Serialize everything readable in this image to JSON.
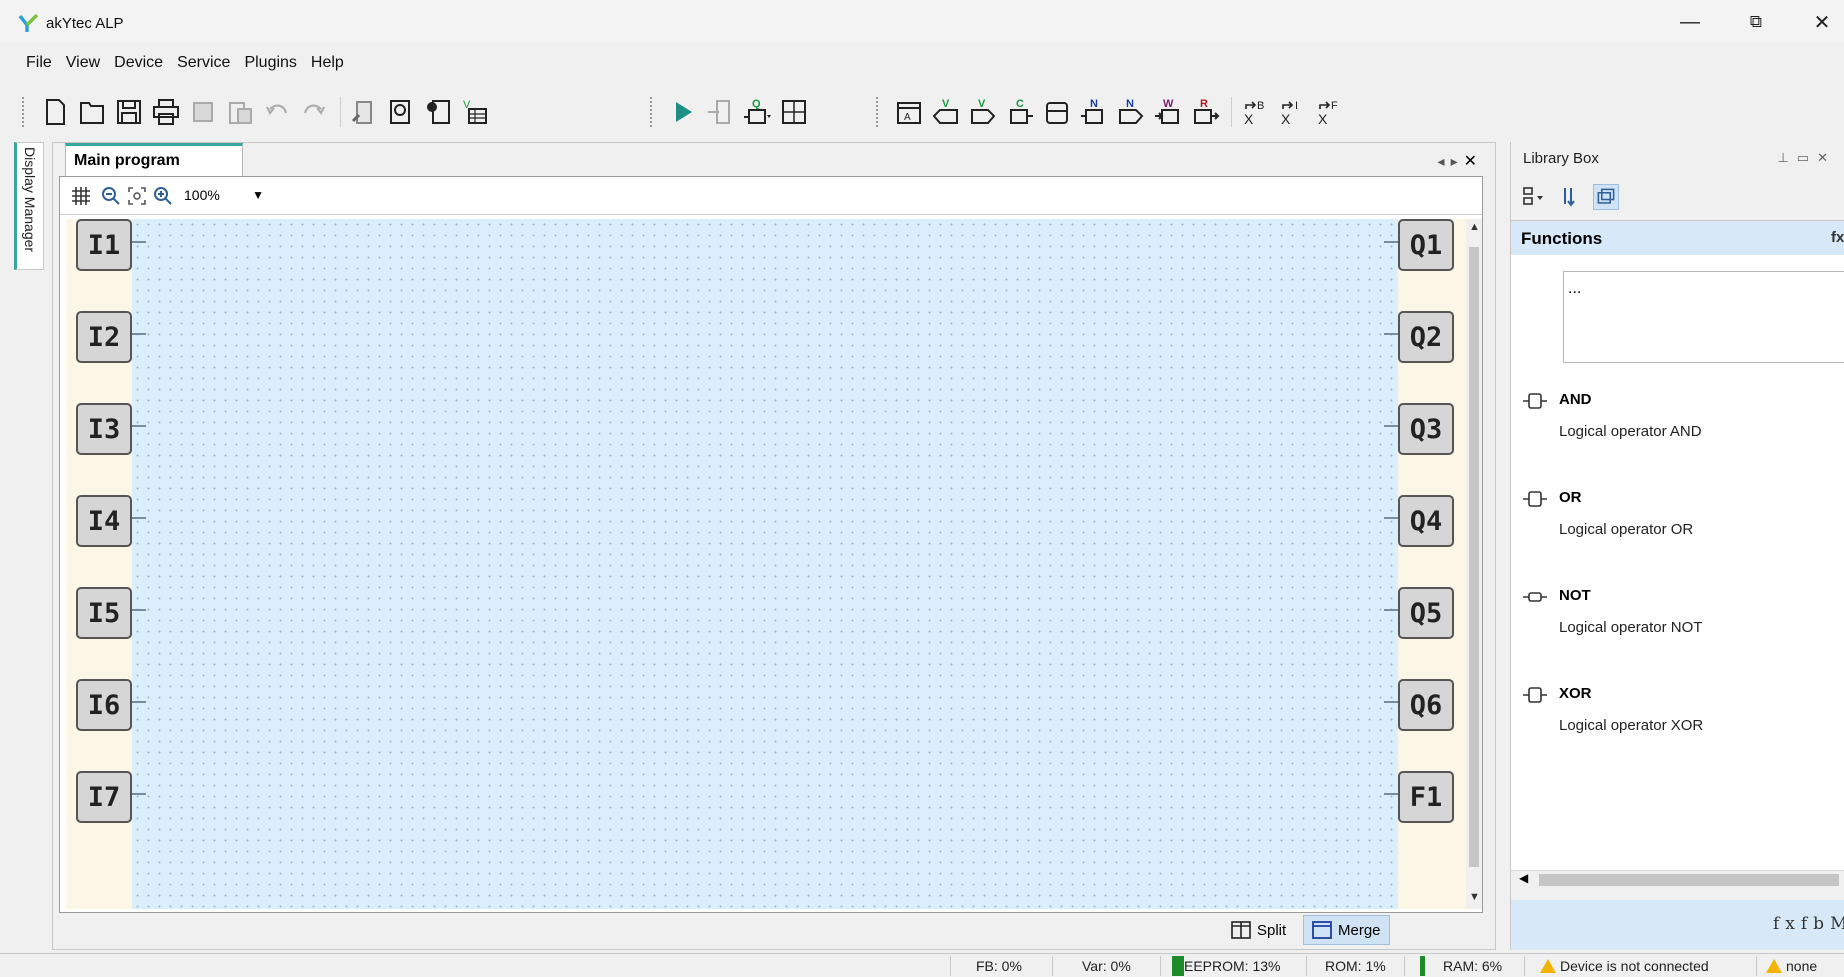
{
  "app": {
    "title": "akYtec ALP"
  },
  "window_controls": {
    "minimize": "—",
    "restore": "⧉",
    "close": "✕"
  },
  "menu": [
    "File",
    "View",
    "Device",
    "Service",
    "Plugins",
    "Help"
  ],
  "side_tab": {
    "label": "Display Manager"
  },
  "document": {
    "tab_label": "Main program",
    "nav": {
      "prev": "◂",
      "next": "▸",
      "close": "✕"
    },
    "zoom": "100%",
    "inputs": [
      "I1",
      "I2",
      "I3",
      "I4",
      "I5",
      "I6",
      "I7"
    ],
    "outputs": [
      "Q1",
      "Q2",
      "Q3",
      "Q4",
      "Q5",
      "Q6",
      "F1"
    ],
    "split_label": "Split",
    "merge_label": "Merge"
  },
  "toolbar": {
    "group1": [
      "new-file-icon",
      "open-folder-icon",
      "save-icon",
      "print-icon",
      "copy-icon",
      "paste-icon",
      "undo-icon",
      "redo-icon",
      "compile-icon",
      "device-info-icon",
      "device-settings-icon",
      "variables-table-icon"
    ],
    "group2": [
      "run-simulation-icon",
      "write-device-icon",
      "output-block-icon",
      "table-icon"
    ],
    "group3_labels": {
      "v1": "V",
      "v2": "V",
      "c": "C",
      "n1": "N",
      "n2": "N",
      "w": "W",
      "r": "R",
      "xb": "B",
      "xi": "I",
      "xf": "F",
      "x": "X"
    }
  },
  "library": {
    "title": "Library Box",
    "header": "Functions",
    "header_icon": "fx",
    "search_text": "...",
    "functions": [
      {
        "name": "AND",
        "description": "Logical operator AND"
      },
      {
        "name": "OR",
        "description": "Logical operator OR"
      },
      {
        "name": "NOT",
        "description": "Logical operator NOT"
      },
      {
        "name": "XOR",
        "description": "Logical operator XOR"
      }
    ],
    "bottom_tabs": [
      "fx",
      "fb",
      "M"
    ]
  },
  "status": {
    "fb": "FB: 0%",
    "var": "Var: 0%",
    "eeprom": "EEPROM: 13%",
    "rom": "ROM: 1%",
    "ram": "RAM: 6%",
    "device": "Device is not connected",
    "port": "none"
  },
  "colors": {
    "accent": "#3aa6a0",
    "canvas": "#dbeefb",
    "selection": "#cfe3f5",
    "memory_bar": "#1c8c2a",
    "warning": "#f2b400"
  }
}
